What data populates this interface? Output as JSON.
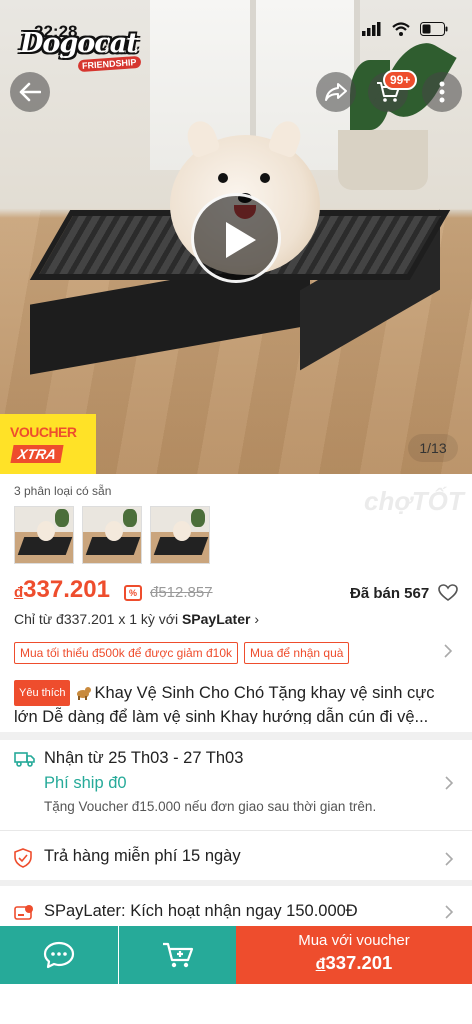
{
  "status_bar": {
    "time": "22:28"
  },
  "logo": {
    "main": "Dogocat",
    "sub": "FRIENDSHIP"
  },
  "header": {
    "cart_badge": "99+"
  },
  "hero": {
    "image_counter": "1/13",
    "voucher_top": "VOUCHER",
    "voucher_bottom": "XTRA"
  },
  "watermark": "chợTỐT",
  "variants": {
    "label": "3 phân loại có sẵn",
    "count": 3
  },
  "price": {
    "currency": "đ",
    "value": "337.201",
    "original": "đ512.857",
    "sold": "Đã bán 567",
    "spay_prefix": "Chỉ từ đ337.201 x 1 kỳ với ",
    "spay_brand": "SPayLater",
    "spay_chevron": "›"
  },
  "tags": [
    "Mua tối thiểu đ500k để được giảm đ10k",
    "Mua để nhận quà"
  ],
  "product": {
    "badge": "Yêu thích",
    "title": "Khay Vệ Sinh Cho Chó Tặng khay vệ sinh cực lớn Dễ dàng để làm vệ sinh Khay hướng dẫn cún đi vệ..."
  },
  "shipping": {
    "date": "Nhận từ 25 Th03 - 27 Th03",
    "fee": "Phí ship đ0",
    "note": "Tặng Voucher đ15.000 nếu đơn giao sau thời gian trên."
  },
  "return_policy": {
    "text": "Trả hàng miễn phí 15 ngày"
  },
  "spaylater_row": {
    "text": "SPayLater: Kích hoạt nhận ngay 150.000Đ"
  },
  "bottom_bar": {
    "buy_label": "Mua với voucher",
    "buy_currency": "đ",
    "buy_price": "337.201"
  },
  "colors": {
    "accent": "#ee4d2d",
    "teal": "#26aa99",
    "voucher_yellow": "#ffe227"
  }
}
